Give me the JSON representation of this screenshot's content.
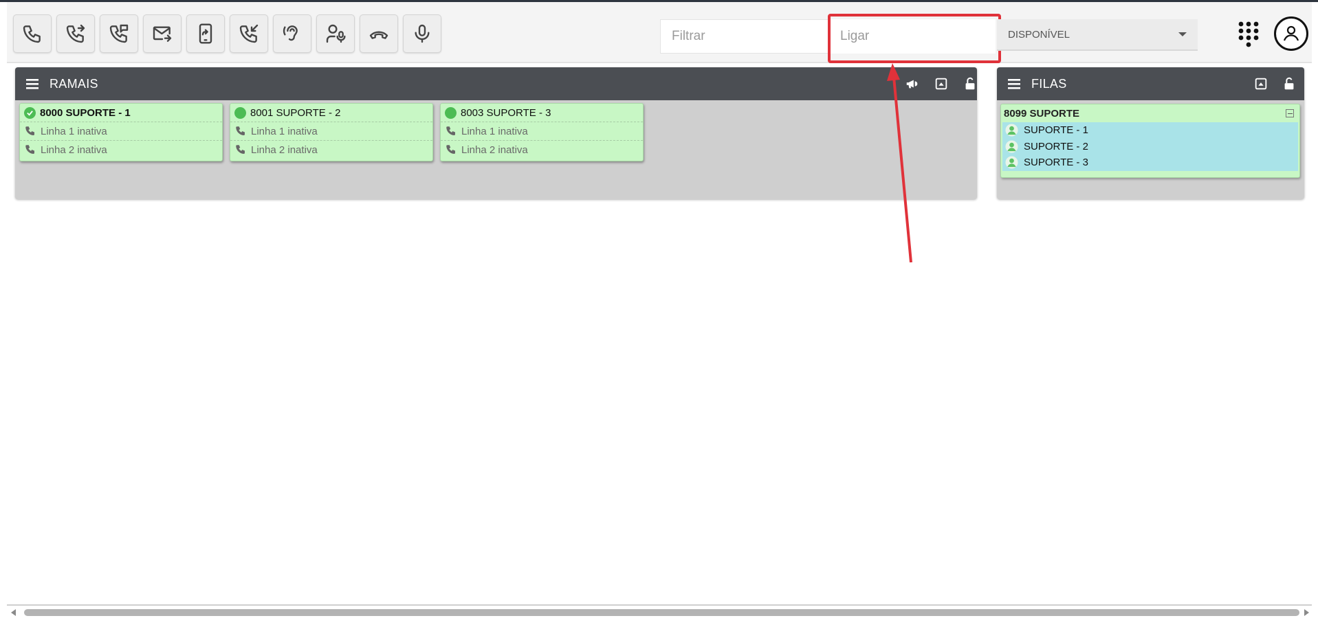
{
  "toolbar": {
    "buttons": [
      {
        "name": "call-button",
        "icon": "phone-icon"
      },
      {
        "name": "transfer-button",
        "icon": "phone-forward-icon"
      },
      {
        "name": "consult-transfer-button",
        "icon": "phone-message-icon"
      },
      {
        "name": "email-forward-button",
        "icon": "mail-forward-icon"
      },
      {
        "name": "mobile-transfer-button",
        "icon": "mobile-transfer-icon"
      },
      {
        "name": "pickup-button",
        "icon": "phone-incoming-icon"
      },
      {
        "name": "listen-button",
        "icon": "ear-icon"
      },
      {
        "name": "whisper-button",
        "icon": "user-mic-icon"
      },
      {
        "name": "hangup-button",
        "icon": "phone-hangup-icon"
      },
      {
        "name": "mute-button",
        "icon": "microphone-icon"
      }
    ],
    "filter_placeholder": "Filtrar",
    "call_placeholder": "Ligar",
    "status_value": "DISPONÍVEL"
  },
  "ramais": {
    "title": "RAMAIS",
    "extensions": [
      {
        "name": "8000 SUPORTE - 1",
        "status": "available-check",
        "line1": "Linha 1 inativa",
        "line2": "Linha 2 inativa"
      },
      {
        "name": "8001 SUPORTE - 2",
        "status": "online",
        "line1": "Linha 1 inativa",
        "line2": "Linha 2 inativa"
      },
      {
        "name": "8003 SUPORTE - 3",
        "status": "online",
        "line1": "Linha 1 inativa",
        "line2": "Linha 2 inativa"
      }
    ]
  },
  "filas": {
    "title": "FILAS",
    "queues": [
      {
        "name": "8099 SUPORTE",
        "members": [
          "SUPORTE - 1",
          "SUPORTE - 2",
          "SUPORTE - 3"
        ]
      }
    ]
  },
  "colors": {
    "header": "#4b4e53",
    "card_green": "#c8f7c5",
    "member_cyan": "#a9e3e8",
    "highlight": "#e0323a",
    "status_green": "#4cbc54"
  }
}
